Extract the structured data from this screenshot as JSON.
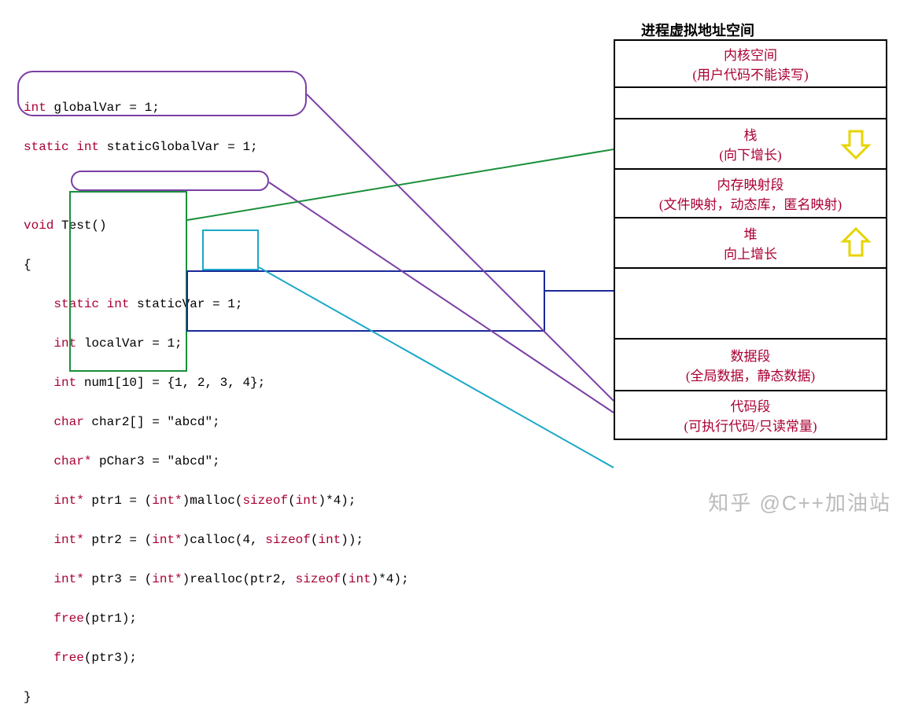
{
  "title": "进程虚拟地址空间",
  "code": {
    "l1": {
      "kw": "int",
      "rest": " globalVar = 1;"
    },
    "l2": {
      "kw": "static int",
      "rest": " staticGlobalVar = 1;"
    },
    "l3": "",
    "l4": {
      "kw": "void",
      "rest": " Test()"
    },
    "l5": "{",
    "l6": {
      "indent": "    ",
      "kw": "static int",
      "rest": " staticVar = 1;"
    },
    "l7": {
      "indent": "    ",
      "kw": "int",
      "rest": " localVar = 1;"
    },
    "l8": {
      "indent": "    ",
      "kw": "int",
      "rest": " num1[10] = {1, 2, 3, 4};"
    },
    "l9": {
      "indent": "    ",
      "kw": "char",
      "rest": " char2[] = \"abcd\";"
    },
    "l10": {
      "indent": "    ",
      "kw": "char*",
      "rest": " pChar3 = \"abcd\";"
    },
    "l11": {
      "indent": "    ",
      "kw": "int*",
      "rest": " ptr1 = (",
      "kw2": "int*",
      "rest2": ")malloc(",
      "kw3": "sizeof",
      "rest3": "(",
      "kw4": "int",
      "rest4": ")*4);"
    },
    "l12": {
      "indent": "    ",
      "kw": "int*",
      "rest": " ptr2 = (",
      "kw2": "int*",
      "rest2": ")calloc(4, ",
      "kw3": "sizeof",
      "rest3": "(",
      "kw4": "int",
      "rest4": "));"
    },
    "l13": {
      "indent": "    ",
      "kw": "int*",
      "rest": " ptr3 = (",
      "kw2": "int*",
      "rest2": ")realloc(ptr2, ",
      "kw3": "sizeof",
      "rest3": "(",
      "kw4": "int",
      "rest4": ")*4);"
    },
    "l14": {
      "indent": "    ",
      "kw": "free",
      "rest": "(ptr1);"
    },
    "l15": {
      "indent": "    ",
      "kw": "free",
      "rest": "(ptr3);"
    },
    "l16": "}"
  },
  "mem": {
    "r1": {
      "a": "内核空间",
      "b": "(用户代码不能读写)"
    },
    "r2": {
      "a": ""
    },
    "r3": {
      "a": "栈",
      "b": "(向下增长)"
    },
    "r4": {
      "a": "内存映射段",
      "b": "(文件映射，动态库，匿名映射)"
    },
    "r5": {
      "a": "堆",
      "b": "向上增长"
    },
    "r6": {
      "a": ""
    },
    "r7": {
      "a": "数据段",
      "b": "(全局数据，静态数据)"
    },
    "r8": {
      "a": "代码段",
      "b": "(可执行代码/只读常量)"
    }
  },
  "watermark": "知乎 @C++加油站"
}
